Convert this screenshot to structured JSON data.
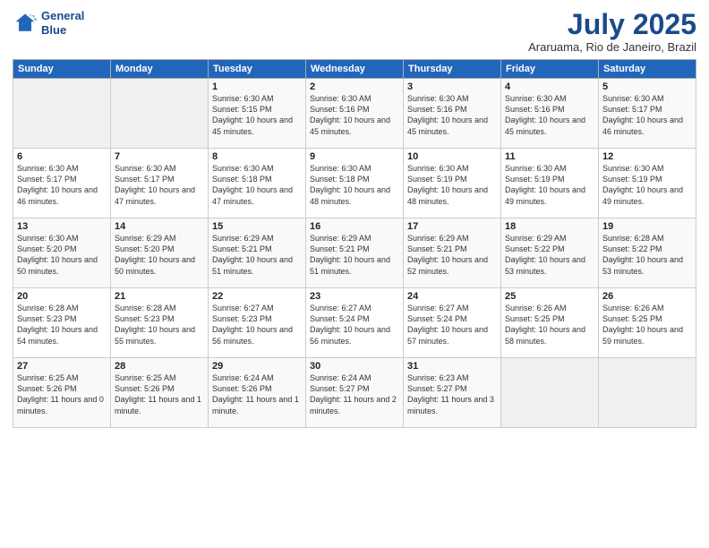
{
  "header": {
    "logo_line1": "General",
    "logo_line2": "Blue",
    "month": "July 2025",
    "location": "Araruama, Rio de Janeiro, Brazil"
  },
  "weekdays": [
    "Sunday",
    "Monday",
    "Tuesday",
    "Wednesday",
    "Thursday",
    "Friday",
    "Saturday"
  ],
  "weeks": [
    [
      {
        "day": "",
        "info": ""
      },
      {
        "day": "",
        "info": ""
      },
      {
        "day": "1",
        "info": "Sunrise: 6:30 AM\nSunset: 5:15 PM\nDaylight: 10 hours and 45 minutes."
      },
      {
        "day": "2",
        "info": "Sunrise: 6:30 AM\nSunset: 5:16 PM\nDaylight: 10 hours and 45 minutes."
      },
      {
        "day": "3",
        "info": "Sunrise: 6:30 AM\nSunset: 5:16 PM\nDaylight: 10 hours and 45 minutes."
      },
      {
        "day": "4",
        "info": "Sunrise: 6:30 AM\nSunset: 5:16 PM\nDaylight: 10 hours and 45 minutes."
      },
      {
        "day": "5",
        "info": "Sunrise: 6:30 AM\nSunset: 5:17 PM\nDaylight: 10 hours and 46 minutes."
      }
    ],
    [
      {
        "day": "6",
        "info": "Sunrise: 6:30 AM\nSunset: 5:17 PM\nDaylight: 10 hours and 46 minutes."
      },
      {
        "day": "7",
        "info": "Sunrise: 6:30 AM\nSunset: 5:17 PM\nDaylight: 10 hours and 47 minutes."
      },
      {
        "day": "8",
        "info": "Sunrise: 6:30 AM\nSunset: 5:18 PM\nDaylight: 10 hours and 47 minutes."
      },
      {
        "day": "9",
        "info": "Sunrise: 6:30 AM\nSunset: 5:18 PM\nDaylight: 10 hours and 48 minutes."
      },
      {
        "day": "10",
        "info": "Sunrise: 6:30 AM\nSunset: 5:19 PM\nDaylight: 10 hours and 48 minutes."
      },
      {
        "day": "11",
        "info": "Sunrise: 6:30 AM\nSunset: 5:19 PM\nDaylight: 10 hours and 49 minutes."
      },
      {
        "day": "12",
        "info": "Sunrise: 6:30 AM\nSunset: 5:19 PM\nDaylight: 10 hours and 49 minutes."
      }
    ],
    [
      {
        "day": "13",
        "info": "Sunrise: 6:30 AM\nSunset: 5:20 PM\nDaylight: 10 hours and 50 minutes."
      },
      {
        "day": "14",
        "info": "Sunrise: 6:29 AM\nSunset: 5:20 PM\nDaylight: 10 hours and 50 minutes."
      },
      {
        "day": "15",
        "info": "Sunrise: 6:29 AM\nSunset: 5:21 PM\nDaylight: 10 hours and 51 minutes."
      },
      {
        "day": "16",
        "info": "Sunrise: 6:29 AM\nSunset: 5:21 PM\nDaylight: 10 hours and 51 minutes."
      },
      {
        "day": "17",
        "info": "Sunrise: 6:29 AM\nSunset: 5:21 PM\nDaylight: 10 hours and 52 minutes."
      },
      {
        "day": "18",
        "info": "Sunrise: 6:29 AM\nSunset: 5:22 PM\nDaylight: 10 hours and 53 minutes."
      },
      {
        "day": "19",
        "info": "Sunrise: 6:28 AM\nSunset: 5:22 PM\nDaylight: 10 hours and 53 minutes."
      }
    ],
    [
      {
        "day": "20",
        "info": "Sunrise: 6:28 AM\nSunset: 5:23 PM\nDaylight: 10 hours and 54 minutes."
      },
      {
        "day": "21",
        "info": "Sunrise: 6:28 AM\nSunset: 5:23 PM\nDaylight: 10 hours and 55 minutes."
      },
      {
        "day": "22",
        "info": "Sunrise: 6:27 AM\nSunset: 5:23 PM\nDaylight: 10 hours and 56 minutes."
      },
      {
        "day": "23",
        "info": "Sunrise: 6:27 AM\nSunset: 5:24 PM\nDaylight: 10 hours and 56 minutes."
      },
      {
        "day": "24",
        "info": "Sunrise: 6:27 AM\nSunset: 5:24 PM\nDaylight: 10 hours and 57 minutes."
      },
      {
        "day": "25",
        "info": "Sunrise: 6:26 AM\nSunset: 5:25 PM\nDaylight: 10 hours and 58 minutes."
      },
      {
        "day": "26",
        "info": "Sunrise: 6:26 AM\nSunset: 5:25 PM\nDaylight: 10 hours and 59 minutes."
      }
    ],
    [
      {
        "day": "27",
        "info": "Sunrise: 6:25 AM\nSunset: 5:26 PM\nDaylight: 11 hours and 0 minutes."
      },
      {
        "day": "28",
        "info": "Sunrise: 6:25 AM\nSunset: 5:26 PM\nDaylight: 11 hours and 1 minute."
      },
      {
        "day": "29",
        "info": "Sunrise: 6:24 AM\nSunset: 5:26 PM\nDaylight: 11 hours and 1 minute."
      },
      {
        "day": "30",
        "info": "Sunrise: 6:24 AM\nSunset: 5:27 PM\nDaylight: 11 hours and 2 minutes."
      },
      {
        "day": "31",
        "info": "Sunrise: 6:23 AM\nSunset: 5:27 PM\nDaylight: 11 hours and 3 minutes."
      },
      {
        "day": "",
        "info": ""
      },
      {
        "day": "",
        "info": ""
      }
    ]
  ]
}
